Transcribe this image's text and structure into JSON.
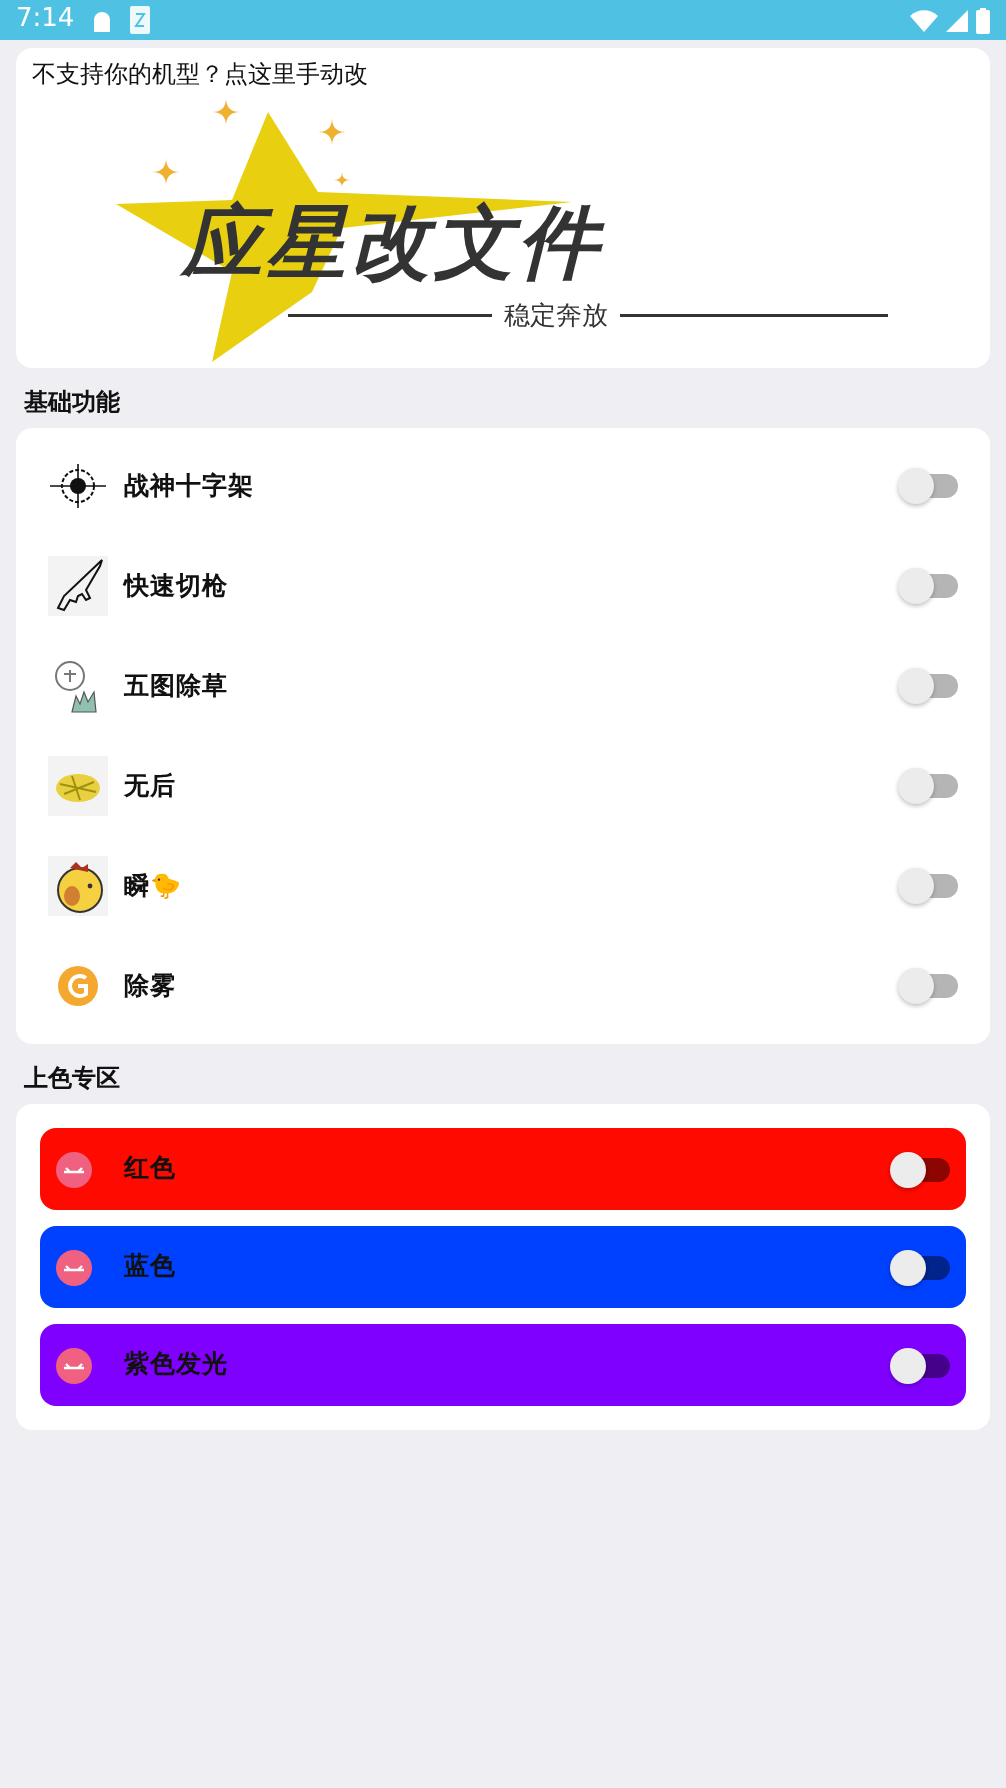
{
  "status_bar": {
    "time": "7:14"
  },
  "header": {
    "notice": "不支持你的机型？点这里手动改",
    "logo_title": "应星改文件",
    "logo_slogan": "稳定奔放"
  },
  "sections": [
    {
      "title": "基础功能",
      "kind": "plain",
      "items": [
        {
          "label": "战神十字架",
          "on": false
        },
        {
          "label": "快速切枪",
          "on": false
        },
        {
          "label": "五图除草",
          "on": false
        },
        {
          "label": "无后",
          "on": false
        },
        {
          "label": "瞬🐤",
          "on": false
        },
        {
          "label": "除雾",
          "on": false
        }
      ]
    },
    {
      "title": "上色专区",
      "kind": "colored",
      "items": [
        {
          "label": "红色",
          "on": false,
          "color": "#ff0a00"
        },
        {
          "label": "蓝色",
          "on": false,
          "color": "#0040ff"
        },
        {
          "label": "紫色发光",
          "on": false,
          "color": "#7f00ff"
        }
      ]
    }
  ]
}
